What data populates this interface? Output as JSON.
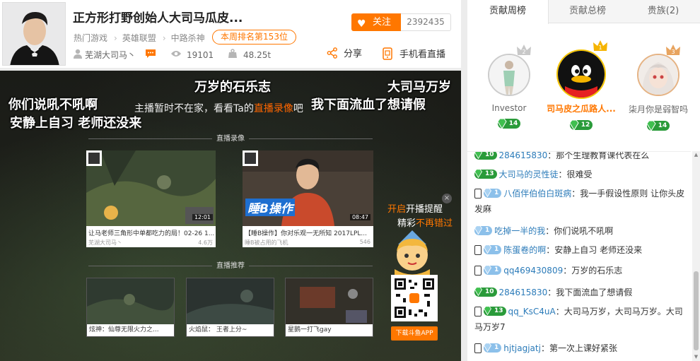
{
  "header": {
    "title": "正方形打野创始人大司马瓜皮...",
    "follow_label": "关注",
    "follow_count": "2392435",
    "crumbs": [
      "热门游戏",
      "英雄联盟",
      "中路杀神"
    ],
    "rank_badge": "本周排名第153位",
    "anchor_name": "芜湖大司马丶",
    "viewers": "19101",
    "weight": "48.25t",
    "share_label": "分享",
    "mobile_label": "手机看直播"
  },
  "video": {
    "danmu": [
      "万岁的石乐志",
      "大司马万岁",
      "你们说吼不吼啊",
      "我下面流血了想请假",
      "安静上自习  老师还没来"
    ],
    "offline_prefix": "主播暂时不在家，看看Ta的",
    "offline_link": "直播录像",
    "offline_suffix": "吧",
    "section_replay": "直播录像",
    "section_recommend": "直播推荐",
    "replays": [
      {
        "caption": "让马老师三角形中单都吃力的局！02-26 1...",
        "author": "芜湖大司马丶",
        "views": "4.6万",
        "duration": "12:01"
      },
      {
        "caption": "【睡B操作】你对乐观一无所知 2017LPL...",
        "author": "睡B被占用的飞机",
        "views": "546",
        "duration": "08:47"
      }
    ],
    "recommends": [
      {
        "caption": "炫神：仙尊无限火力之..."
      },
      {
        "caption": "火焰鼠： 王者上分~"
      },
      {
        "caption": "星鹅一打飞gay"
      }
    ],
    "promo": {
      "line1_o": "开启",
      "line1": "开播提醒",
      "line2": "精彩",
      "line2_o": "不再错过",
      "close": "×",
      "app_button": "下载斗鱼APP"
    },
    "thumb_text": "睡B操作"
  },
  "panel": {
    "tabs": [
      "贡献周榜",
      "贡献总榜",
      "贵族(2)"
    ],
    "top3": [
      {
        "name": "Investor",
        "level": "14",
        "rank": "2"
      },
      {
        "name": "司马皮之瓜路人...",
        "level": "12",
        "rank": "1"
      },
      {
        "name": "柒月你是弱智吗",
        "level": "14",
        "rank": "3"
      }
    ],
    "chat": [
      {
        "lv": "10",
        "user": "284615830",
        "text": "：那个生理教育课代表在么",
        "mobile": false,
        "color": "g10"
      },
      {
        "lv": "13",
        "user": "大司马的灵性徒",
        "text": "：很难受",
        "mobile": false,
        "color": "g13"
      },
      {
        "lv": "1",
        "user": "八佰伴伯伯白斑病",
        "text": "：我一手假设性原则 让你头皮发麻",
        "mobile": true,
        "color": "b1"
      },
      {
        "lv": "1",
        "user": "吃掉一半的我",
        "text": "：你们说吼不吼啊",
        "mobile": false,
        "color": "b1"
      },
      {
        "lv": "1",
        "user": "陈蛋卷的啊",
        "text": "：安静上自习 老师还没来",
        "mobile": true,
        "color": "b1"
      },
      {
        "lv": "1",
        "user": "qq469430809",
        "text": "：万岁的石乐志",
        "mobile": true,
        "color": "b1"
      },
      {
        "lv": "10",
        "user": "284615830",
        "text": "：我下面流血了想请假",
        "mobile": false,
        "color": "g10"
      },
      {
        "lv": "13",
        "user": "qq_KsC4uA",
        "text": "：大司马万岁，大司马万岁。大司马万岁7",
        "mobile": true,
        "color": "g13"
      },
      {
        "lv": "1",
        "user": "hjtjagjatj",
        "text": "：第一次上课好紧张",
        "mobile": true,
        "color": "b1"
      }
    ]
  },
  "colors": {
    "accent": "#ff7700",
    "username": "#2b7bb9",
    "level_green": "#2a9b3a",
    "level_blue": "#8cc0ea"
  },
  "icons": [
    "heart-icon",
    "user-icon",
    "chat-bubble-icon",
    "eye-icon",
    "weight-icon",
    "share-icon",
    "phone-icon",
    "gem-icon",
    "crown-icon"
  ]
}
